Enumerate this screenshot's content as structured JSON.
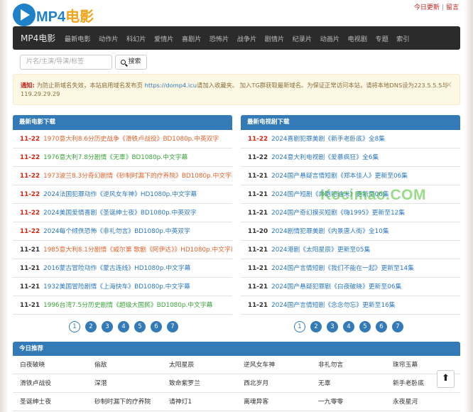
{
  "logo": {
    "part1": "MP4",
    "part2": "电影"
  },
  "toplinks": {
    "today": "今日更新",
    "message": "留言"
  },
  "nav": {
    "brand": "MP4电影",
    "items": [
      "最新电影",
      "动作片",
      "科幻片",
      "爱情片",
      "喜剧片",
      "恐怖片",
      "战争片",
      "剧情片",
      "纪录片",
      "动画片",
      "电视剧",
      "专题",
      "索引"
    ]
  },
  "search": {
    "placeholder": "片名/主演/导演/标签",
    "button": "搜索"
  },
  "notice": {
    "label": "通知:",
    "text1": "为防止新域名失效，本站启用域名发布页",
    "link": "https://domp4.icu",
    "text2": "请加入收藏夹。 加入TG群获取最新域名。为保证正常访问本站，请将本地DNS设为223.5.5.5与119.29.29.29",
    "close": "×"
  },
  "movies": {
    "title": "最新电影下载",
    "items": [
      {
        "date": "11-22",
        "text": "1970意大利8.6分历史战争《滑铁卢战役》BD1080p.中英双字"
      },
      {
        "date": "11-22",
        "text": "1976意大利7.8分剧情《无辜》BD1080p.中文字幕"
      },
      {
        "date": "11-22",
        "text": "1973波兰8.3分奇幻剧情《砂制时漏下的疗养院》BD1080p.中文字幕"
      },
      {
        "date": "11-22",
        "text": "2024法国犯罪动作《逆风女车神》HD1080p.中文字幕"
      },
      {
        "date": "11-22",
        "text": "2024美国爱情喜剧《圣诞绅士夜》BD1080p.中英双字"
      },
      {
        "date": "11-22",
        "text": "2024每个倾佚恐怖《非礼勿言》BD1080p.中英双字"
      },
      {
        "date": "11-21",
        "text": "1985意大利8.1分剧情《威尔第 歌剧《阿伊达》》HD1080p.中文字幕"
      },
      {
        "date": "11-21",
        "text": "2016蒙古冒险动作《蒙古连线》HD1080p.中文字幕"
      },
      {
        "date": "11-21",
        "text": "1932美国冒险剧情《上海快车》BD1080p.中文字幕"
      },
      {
        "date": "11-21",
        "text": "1996台湾7.5分历史剧情《超级大国民》BD1080p.中文字幕"
      }
    ]
  },
  "tv": {
    "title": "最新电视剧下载",
    "items": [
      {
        "date": "11-22",
        "text": "2024喜剧犯罪美剧《新手老卧底》全8集"
      },
      {
        "date": "11-22",
        "text": "2024意大利电视剧《爱慕疯狂》全6集"
      },
      {
        "date": "11-21",
        "text": "2024国产悬疑言情短剧《郑本佳人》更新至06集"
      },
      {
        "date": "11-21",
        "text": "2024国产短剧《奔跑吧迪米》更新至06集"
      },
      {
        "date": "11-21",
        "text": "2024国产奇幻摸买短剧《嗨1995》更新至12集"
      },
      {
        "date": "11-20",
        "text": "2024剧情犯罪美剧《内景唐人街》全10集"
      },
      {
        "date": "11-21",
        "text": "2024港剧《太阳星辰》更新至05集"
      },
      {
        "date": "11-21",
        "text": "2024国产言情短剧《我们不能在一起》更新至14集"
      },
      {
        "date": "11-21",
        "text": "2024国产悬疑犯罪剧《白夜破晓》更新至06集"
      },
      {
        "date": "11-21",
        "text": "2024国产言情短剧《念念勿忘》更新至16集"
      }
    ]
  },
  "pager_left": [
    "1",
    "2",
    "3",
    "4",
    "5",
    "6",
    "7"
  ],
  "pager_right": [
    "1",
    "2",
    "3",
    "4",
    "5",
    "6",
    "7"
  ],
  "recommend": {
    "title": "今日推荐",
    "items": [
      "白夜破晓",
      "偷敌",
      "太阳星辰",
      "逆风女车神",
      "非礼勿言",
      "珠帘玉幕",
      "滑铁卢战役",
      "深潜",
      "致命紫罗兰",
      "西北岁月",
      "无辜",
      "新手老卧底",
      "圣诞绅士夜",
      "砂制时漏下的疗养院",
      "请神灯1",
      "离魂异客",
      "一九零零",
      "永夜星河"
    ]
  },
  "totop": "⬆",
  "watermark": "Kocimao.COM",
  "colors": {
    "accent": "#337ab7",
    "nav_bg": "#2b2b2b",
    "date_red": "#d9230f",
    "notice_bg": "#fcf8e3"
  }
}
